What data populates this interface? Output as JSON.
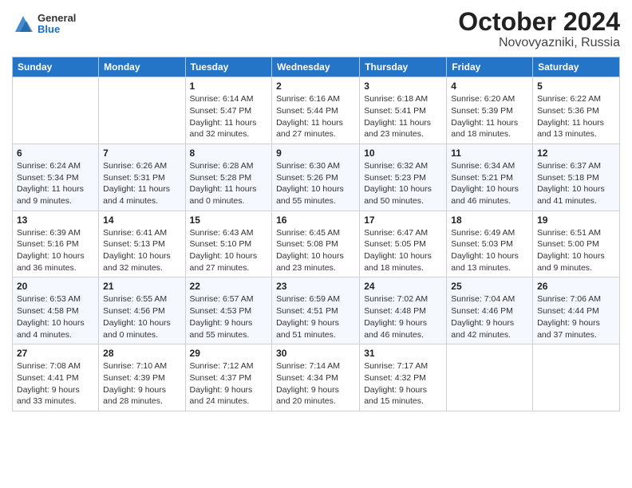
{
  "header": {
    "logo_general": "General",
    "logo_blue": "Blue",
    "title": "October 2024",
    "subtitle": "Novovyazniki, Russia"
  },
  "days_of_week": [
    "Sunday",
    "Monday",
    "Tuesday",
    "Wednesday",
    "Thursday",
    "Friday",
    "Saturday"
  ],
  "weeks": [
    [
      {
        "day": "",
        "sunrise": "",
        "sunset": "",
        "daylight": ""
      },
      {
        "day": "",
        "sunrise": "",
        "sunset": "",
        "daylight": ""
      },
      {
        "day": "1",
        "sunrise": "Sunrise: 6:14 AM",
        "sunset": "Sunset: 5:47 PM",
        "daylight": "Daylight: 11 hours and 32 minutes."
      },
      {
        "day": "2",
        "sunrise": "Sunrise: 6:16 AM",
        "sunset": "Sunset: 5:44 PM",
        "daylight": "Daylight: 11 hours and 27 minutes."
      },
      {
        "day": "3",
        "sunrise": "Sunrise: 6:18 AM",
        "sunset": "Sunset: 5:41 PM",
        "daylight": "Daylight: 11 hours and 23 minutes."
      },
      {
        "day": "4",
        "sunrise": "Sunrise: 6:20 AM",
        "sunset": "Sunset: 5:39 PM",
        "daylight": "Daylight: 11 hours and 18 minutes."
      },
      {
        "day": "5",
        "sunrise": "Sunrise: 6:22 AM",
        "sunset": "Sunset: 5:36 PM",
        "daylight": "Daylight: 11 hours and 13 minutes."
      }
    ],
    [
      {
        "day": "6",
        "sunrise": "Sunrise: 6:24 AM",
        "sunset": "Sunset: 5:34 PM",
        "daylight": "Daylight: 11 hours and 9 minutes."
      },
      {
        "day": "7",
        "sunrise": "Sunrise: 6:26 AM",
        "sunset": "Sunset: 5:31 PM",
        "daylight": "Daylight: 11 hours and 4 minutes."
      },
      {
        "day": "8",
        "sunrise": "Sunrise: 6:28 AM",
        "sunset": "Sunset: 5:28 PM",
        "daylight": "Daylight: 11 hours and 0 minutes."
      },
      {
        "day": "9",
        "sunrise": "Sunrise: 6:30 AM",
        "sunset": "Sunset: 5:26 PM",
        "daylight": "Daylight: 10 hours and 55 minutes."
      },
      {
        "day": "10",
        "sunrise": "Sunrise: 6:32 AM",
        "sunset": "Sunset: 5:23 PM",
        "daylight": "Daylight: 10 hours and 50 minutes."
      },
      {
        "day": "11",
        "sunrise": "Sunrise: 6:34 AM",
        "sunset": "Sunset: 5:21 PM",
        "daylight": "Daylight: 10 hours and 46 minutes."
      },
      {
        "day": "12",
        "sunrise": "Sunrise: 6:37 AM",
        "sunset": "Sunset: 5:18 PM",
        "daylight": "Daylight: 10 hours and 41 minutes."
      }
    ],
    [
      {
        "day": "13",
        "sunrise": "Sunrise: 6:39 AM",
        "sunset": "Sunset: 5:16 PM",
        "daylight": "Daylight: 10 hours and 36 minutes."
      },
      {
        "day": "14",
        "sunrise": "Sunrise: 6:41 AM",
        "sunset": "Sunset: 5:13 PM",
        "daylight": "Daylight: 10 hours and 32 minutes."
      },
      {
        "day": "15",
        "sunrise": "Sunrise: 6:43 AM",
        "sunset": "Sunset: 5:10 PM",
        "daylight": "Daylight: 10 hours and 27 minutes."
      },
      {
        "day": "16",
        "sunrise": "Sunrise: 6:45 AM",
        "sunset": "Sunset: 5:08 PM",
        "daylight": "Daylight: 10 hours and 23 minutes."
      },
      {
        "day": "17",
        "sunrise": "Sunrise: 6:47 AM",
        "sunset": "Sunset: 5:05 PM",
        "daylight": "Daylight: 10 hours and 18 minutes."
      },
      {
        "day": "18",
        "sunrise": "Sunrise: 6:49 AM",
        "sunset": "Sunset: 5:03 PM",
        "daylight": "Daylight: 10 hours and 13 minutes."
      },
      {
        "day": "19",
        "sunrise": "Sunrise: 6:51 AM",
        "sunset": "Sunset: 5:00 PM",
        "daylight": "Daylight: 10 hours and 9 minutes."
      }
    ],
    [
      {
        "day": "20",
        "sunrise": "Sunrise: 6:53 AM",
        "sunset": "Sunset: 4:58 PM",
        "daylight": "Daylight: 10 hours and 4 minutes."
      },
      {
        "day": "21",
        "sunrise": "Sunrise: 6:55 AM",
        "sunset": "Sunset: 4:56 PM",
        "daylight": "Daylight: 10 hours and 0 minutes."
      },
      {
        "day": "22",
        "sunrise": "Sunrise: 6:57 AM",
        "sunset": "Sunset: 4:53 PM",
        "daylight": "Daylight: 9 hours and 55 minutes."
      },
      {
        "day": "23",
        "sunrise": "Sunrise: 6:59 AM",
        "sunset": "Sunset: 4:51 PM",
        "daylight": "Daylight: 9 hours and 51 minutes."
      },
      {
        "day": "24",
        "sunrise": "Sunrise: 7:02 AM",
        "sunset": "Sunset: 4:48 PM",
        "daylight": "Daylight: 9 hours and 46 minutes."
      },
      {
        "day": "25",
        "sunrise": "Sunrise: 7:04 AM",
        "sunset": "Sunset: 4:46 PM",
        "daylight": "Daylight: 9 hours and 42 minutes."
      },
      {
        "day": "26",
        "sunrise": "Sunrise: 7:06 AM",
        "sunset": "Sunset: 4:44 PM",
        "daylight": "Daylight: 9 hours and 37 minutes."
      }
    ],
    [
      {
        "day": "27",
        "sunrise": "Sunrise: 7:08 AM",
        "sunset": "Sunset: 4:41 PM",
        "daylight": "Daylight: 9 hours and 33 minutes."
      },
      {
        "day": "28",
        "sunrise": "Sunrise: 7:10 AM",
        "sunset": "Sunset: 4:39 PM",
        "daylight": "Daylight: 9 hours and 28 minutes."
      },
      {
        "day": "29",
        "sunrise": "Sunrise: 7:12 AM",
        "sunset": "Sunset: 4:37 PM",
        "daylight": "Daylight: 9 hours and 24 minutes."
      },
      {
        "day": "30",
        "sunrise": "Sunrise: 7:14 AM",
        "sunset": "Sunset: 4:34 PM",
        "daylight": "Daylight: 9 hours and 20 minutes."
      },
      {
        "day": "31",
        "sunrise": "Sunrise: 7:17 AM",
        "sunset": "Sunset: 4:32 PM",
        "daylight": "Daylight: 9 hours and 15 minutes."
      },
      {
        "day": "",
        "sunrise": "",
        "sunset": "",
        "daylight": ""
      },
      {
        "day": "",
        "sunrise": "",
        "sunset": "",
        "daylight": ""
      }
    ]
  ]
}
